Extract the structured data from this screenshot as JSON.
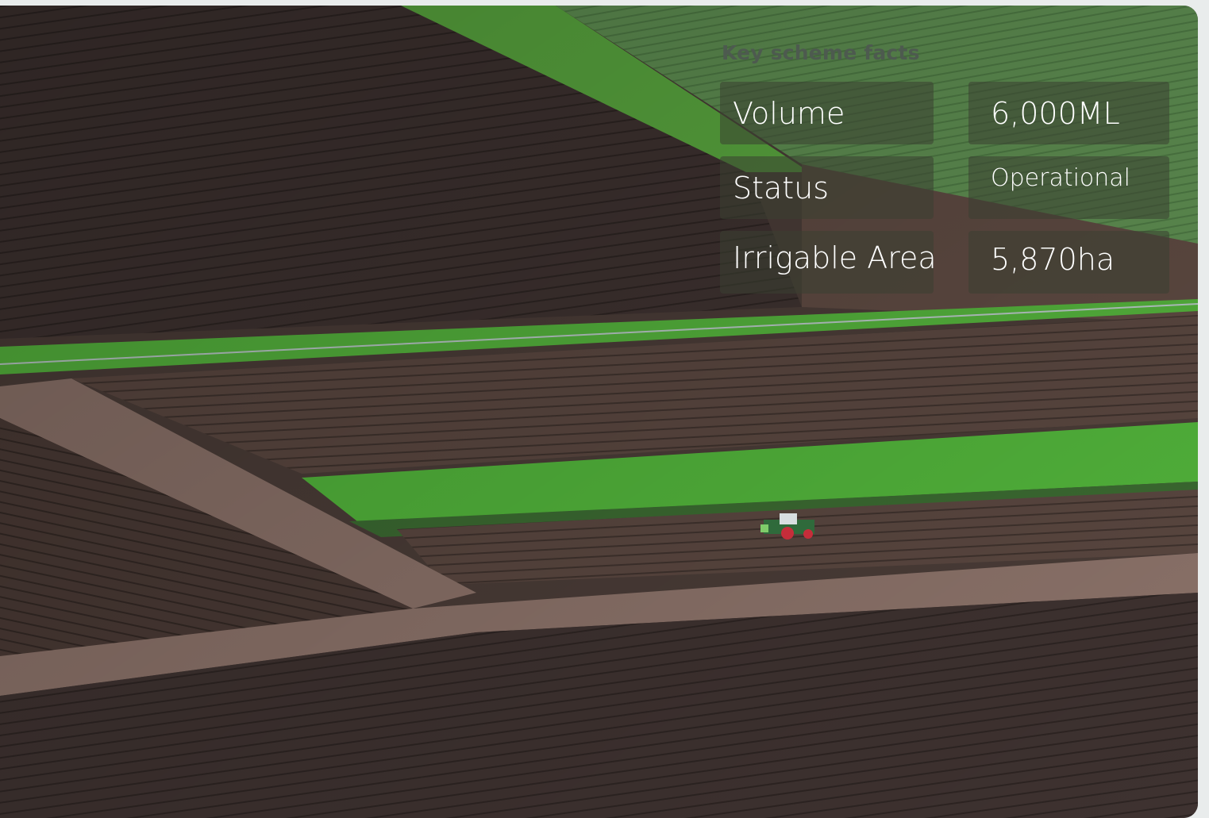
{
  "facts": {
    "heading": "Key scheme facts",
    "rows": [
      {
        "label": "Volume",
        "value": "6,000ML"
      },
      {
        "label": "Status",
        "value": "Operational"
      },
      {
        "label": "Irrigable Area",
        "value": "5,870ha"
      }
    ]
  },
  "colors": {
    "page_background": "#e9ecec",
    "heading_text": "#4d5a4f",
    "panel_fill": "#3a4032",
    "panel_text": "#ffffff",
    "soil_dark": "#3b302d",
    "soil_light": "#7a645b",
    "crop_green": "#4cb23a"
  }
}
